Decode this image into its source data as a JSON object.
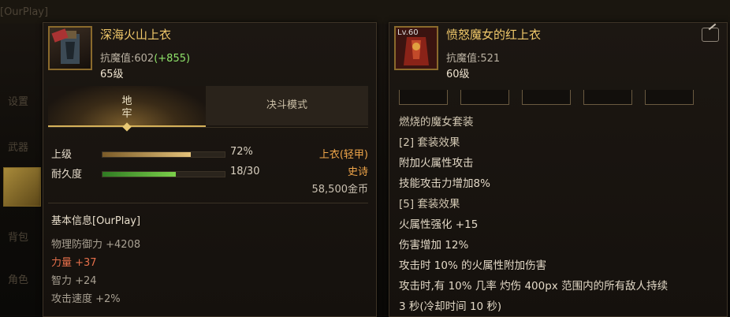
{
  "background": {
    "top_tab": "[OurPlay]",
    "side_labels": [
      "设置",
      "武器",
      "背包",
      "角色"
    ]
  },
  "left_item": {
    "icon_name": "armor-icon",
    "title": "深海火山上衣",
    "stat_label": "抗魔值:602",
    "stat_bonus": "(+855)",
    "level": "65级",
    "tabs": {
      "active": "地\n牢",
      "inactive": "决斗模式"
    },
    "exp": {
      "label": "上级",
      "percent": 72,
      "value_text": "72%"
    },
    "durability": {
      "label": "耐久度",
      "current": 18,
      "max": 30,
      "value_text": "18/30"
    },
    "type": "上衣(轻甲)",
    "rarity": "史诗",
    "price": "58,500金币",
    "basic_title": "基本信息[OurPlay]",
    "stats": [
      {
        "text": "物理防御力 +4208",
        "highlight": false
      },
      {
        "text": "力量 +37",
        "highlight": true
      },
      {
        "text": "智力 +24",
        "highlight": false
      },
      {
        "text": "攻击速度 +2%",
        "highlight": false
      }
    ]
  },
  "right_item": {
    "icon_name": "witch-armor-icon",
    "icon_level": "Lv.60",
    "title": "愤怒魔女的红上衣",
    "stat_label": "抗魔值:521",
    "level": "60级",
    "lines": [
      "燃烧的魔女套装",
      "[2] 套装效果",
      "附加火属性攻击",
      "技能攻击力增加8%",
      "[5] 套装效果",
      "火属性强化 +15",
      "伤害增加 12%",
      "攻击时 10% 的火属性附加伤害",
      "攻击时,有 10% 几率 灼伤 400px 范围内的所有敌人持续",
      "3 秒(冷却时间 10 秒)"
    ]
  },
  "colors": {
    "title": "#f0c86a",
    "bonus": "#8fe36a",
    "type": "#f0a64a",
    "red_stat": "#e56f4a"
  }
}
